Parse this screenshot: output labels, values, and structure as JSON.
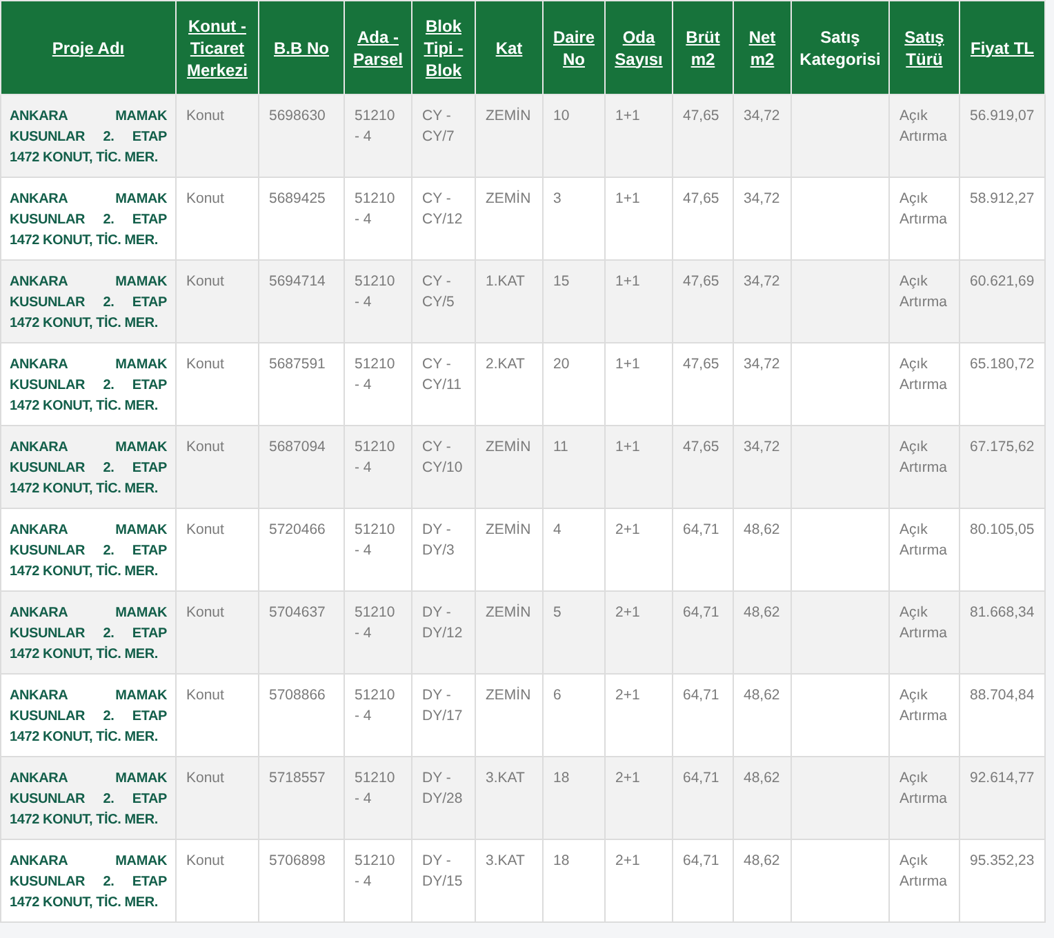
{
  "table": {
    "columns": [
      "Proje Adı",
      "Konut - Ticaret Merkezi",
      "B.B No",
      "Ada - Parsel",
      "Blok Tipi - Blok",
      "Kat",
      "Daire No",
      "Oda Sayısı",
      "Brüt m2",
      "Net m2",
      "Satış Kategorisi",
      "Satış Türü",
      "Fiyat TL"
    ],
    "rows": [
      [
        "ANKARA MAMAK KUSUNLAR 2. ETAP 1472 KONUT, TİC. MER.",
        "Konut",
        "5698630",
        "51210 - 4",
        "CY - CY/7",
        "ZEMİN",
        "10",
        "1+1",
        "47,65",
        "34,72",
        null,
        "Açık Artırma",
        "56.919,07"
      ],
      [
        "ANKARA MAMAK KUSUNLAR 2. ETAP 1472 KONUT, TİC. MER.",
        "Konut",
        "5689425",
        "51210 - 4",
        "CY - CY/12",
        "ZEMİN",
        "3",
        "1+1",
        "47,65",
        "34,72",
        null,
        "Açık Artırma",
        "58.912,27"
      ],
      [
        "ANKARA MAMAK KUSUNLAR 2. ETAP 1472 KONUT, TİC. MER.",
        "Konut",
        "5694714",
        "51210 - 4",
        "CY - CY/5",
        "1.KAT",
        "15",
        "1+1",
        "47,65",
        "34,72",
        null,
        "Açık Artırma",
        "60.621,69"
      ],
      [
        "ANKARA MAMAK KUSUNLAR 2. ETAP 1472 KONUT, TİC. MER.",
        "Konut",
        "5687591",
        "51210 - 4",
        "CY - CY/11",
        "2.KAT",
        "20",
        "1+1",
        "47,65",
        "34,72",
        null,
        "Açık Artırma",
        "65.180,72"
      ],
      [
        "ANKARA MAMAK KUSUNLAR 2. ETAP 1472 KONUT, TİC. MER.",
        "Konut",
        "5687094",
        "51210 - 4",
        "CY - CY/10",
        "ZEMİN",
        "11",
        "1+1",
        "47,65",
        "34,72",
        null,
        "Açık Artırma",
        "67.175,62"
      ],
      [
        "ANKARA MAMAK KUSUNLAR 2. ETAP 1472 KONUT, TİC. MER.",
        "Konut",
        "5720466",
        "51210 - 4",
        "DY - DY/3",
        "ZEMİN",
        "4",
        "2+1",
        "64,71",
        "48,62",
        null,
        "Açık Artırma",
        "80.105,05"
      ],
      [
        "ANKARA MAMAK KUSUNLAR 2. ETAP 1472 KONUT, TİC. MER.",
        "Konut",
        "5704637",
        "51210 - 4",
        "DY - DY/12",
        "ZEMİN",
        "5",
        "2+1",
        "64,71",
        "48,62",
        null,
        "Açık Artırma",
        "81.668,34"
      ],
      [
        "ANKARA MAMAK KUSUNLAR 2. ETAP 1472 KONUT, TİC. MER.",
        "Konut",
        "5708866",
        "51210 - 4",
        "DY - DY/17",
        "ZEMİN",
        "6",
        "2+1",
        "64,71",
        "48,62",
        null,
        "Açık Artırma",
        "88.704,84"
      ],
      [
        "ANKARA MAMAK KUSUNLAR 2. ETAP 1472 KONUT, TİC. MER.",
        "Konut",
        "5718557",
        "51210 - 4",
        "DY - DY/28",
        "3.KAT",
        "18",
        "2+1",
        "64,71",
        "48,62",
        null,
        "Açık Artırma",
        "92.614,77"
      ],
      [
        "ANKARA MAMAK KUSUNLAR 2. ETAP 1472 KONUT, TİC. MER.",
        "Konut",
        "5706898",
        "51210 - 4",
        "DY - DY/15",
        "3.KAT",
        "18",
        "2+1",
        "64,71",
        "48,62",
        null,
        "Açık Artırma",
        "95.352,23"
      ]
    ]
  }
}
